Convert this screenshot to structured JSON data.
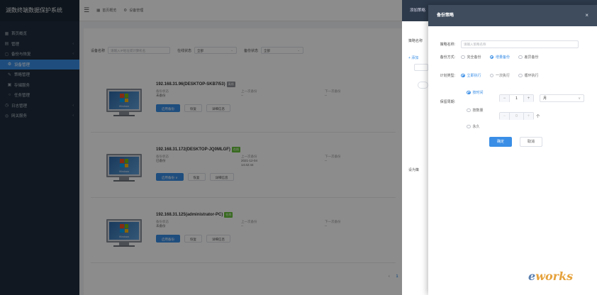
{
  "app": {
    "title": "湖数终端数据保护系统"
  },
  "sidebar": {
    "items": [
      {
        "icon": "dashboard-icon",
        "glyph": "▦",
        "label": "首页概览",
        "active": false,
        "sub": false,
        "arrow": false
      },
      {
        "icon": "manage-icon",
        "glyph": "▤",
        "label": "管理",
        "active": false,
        "sub": false,
        "arrow": true
      },
      {
        "icon": "backup-icon",
        "glyph": "◻",
        "label": "备份与恢复",
        "active": false,
        "sub": false,
        "arrow": true
      },
      {
        "icon": "device-icon",
        "glyph": "⚙",
        "label": "设备管理",
        "active": true,
        "sub": true,
        "arrow": false
      },
      {
        "icon": "policy-icon",
        "glyph": "✎",
        "label": "策略管理",
        "active": false,
        "sub": true,
        "arrow": false
      },
      {
        "icon": "restore-icon",
        "glyph": "▣",
        "label": "存储服务",
        "active": false,
        "sub": true,
        "arrow": false
      },
      {
        "icon": "task-icon",
        "glyph": "○",
        "label": "任务管理",
        "active": false,
        "sub": true,
        "arrow": false
      },
      {
        "icon": "log-icon",
        "glyph": "◷",
        "label": "日志管理",
        "active": false,
        "sub": false,
        "arrow": true
      },
      {
        "icon": "service-icon",
        "glyph": "◎",
        "label": "网关服务",
        "active": false,
        "sub": false,
        "arrow": true
      }
    ]
  },
  "header": {
    "tabs": [
      {
        "icon": "home-icon",
        "glyph": "▦",
        "label": "首页概览"
      },
      {
        "icon": "device-tab-icon",
        "glyph": "⚙",
        "label": "设备管理"
      }
    ]
  },
  "filters": {
    "device_name_label": "设备名称",
    "device_name_placeholder": "请输入IP地址或计算机名",
    "online_label": "在线状态",
    "online_value": "全部",
    "backup_label": "备份状态",
    "backup_value": "全部"
  },
  "devices": [
    {
      "name": "192.168.31.96(DESKTOP-SKB7I53)",
      "status": "离线",
      "online": false,
      "state_label": "备份状态",
      "state_value": "未备份",
      "last_label": "上一次备份",
      "last_value": "--",
      "next_label": "下一次备份",
      "next_value": "--",
      "btn1": "启用备份",
      "btn2": "恢复",
      "btn3": "详细信息"
    },
    {
      "name": "192.168.31.172(DESKTOP-JQ0MLGF)",
      "status": "在线",
      "online": true,
      "state_label": "备份状态",
      "state_value": "已备份",
      "last_label": "上一次备份",
      "last_value": "2021-12-04",
      "last_value2": "14:42:44",
      "next_label": "下一次备份",
      "next_value": "--",
      "btn1": "启用备份 ∨",
      "btn2": "恢复",
      "btn3": "详细信息"
    },
    {
      "name": "192.168.31.125(administrator-PC)",
      "status": "在线",
      "online": true,
      "state_label": "备份状态",
      "state_value": "未备份",
      "last_label": "上一次备份",
      "last_value": "--",
      "next_label": "下一次备份",
      "next_value": "--",
      "btn1": "启用备份",
      "btn2": "恢复",
      "btn3": "详细信息"
    }
  ],
  "monitor_text": "Windows",
  "pager": {
    "prev": "‹",
    "page": "1",
    "next": "›",
    "goto_label": "前往",
    "goto_value": "1",
    "page_suffix": "页"
  },
  "back_panel": {
    "title": "添加策略",
    "label1": "策略名称",
    "add": "+ 添加",
    "label2": "保存类",
    "label3": "设为策"
  },
  "dialog": {
    "title": "备份策略",
    "close": "×",
    "name_label": "策略名称:",
    "name_placeholder": "请输入策略名称",
    "mode_label": "备份方式:",
    "mode_options": [
      {
        "label": "完全备份",
        "on": false
      },
      {
        "label": "增量备份",
        "on": true
      },
      {
        "label": "差异备份",
        "on": false
      }
    ],
    "plan_label": "计划类型:",
    "plan_options": [
      {
        "label": "立即执行",
        "on": true
      },
      {
        "label": "一次执行",
        "on": false
      },
      {
        "label": "循环执行",
        "on": false
      }
    ],
    "retain_label": "保留周期:",
    "retain_time": {
      "label": "按时间",
      "on": true,
      "minus": "−",
      "value": "1",
      "plus": "+",
      "unit": "月",
      "chevron": "∨"
    },
    "retain_count": {
      "label": "按数量",
      "on": false,
      "minus": "−",
      "value": "0",
      "plus": "+",
      "unit": "个"
    },
    "retain_forever": {
      "label": "永久",
      "on": false
    },
    "confirm": "确定",
    "cancel": "取消"
  },
  "watermark": {
    "left": "e",
    "right": "works"
  }
}
